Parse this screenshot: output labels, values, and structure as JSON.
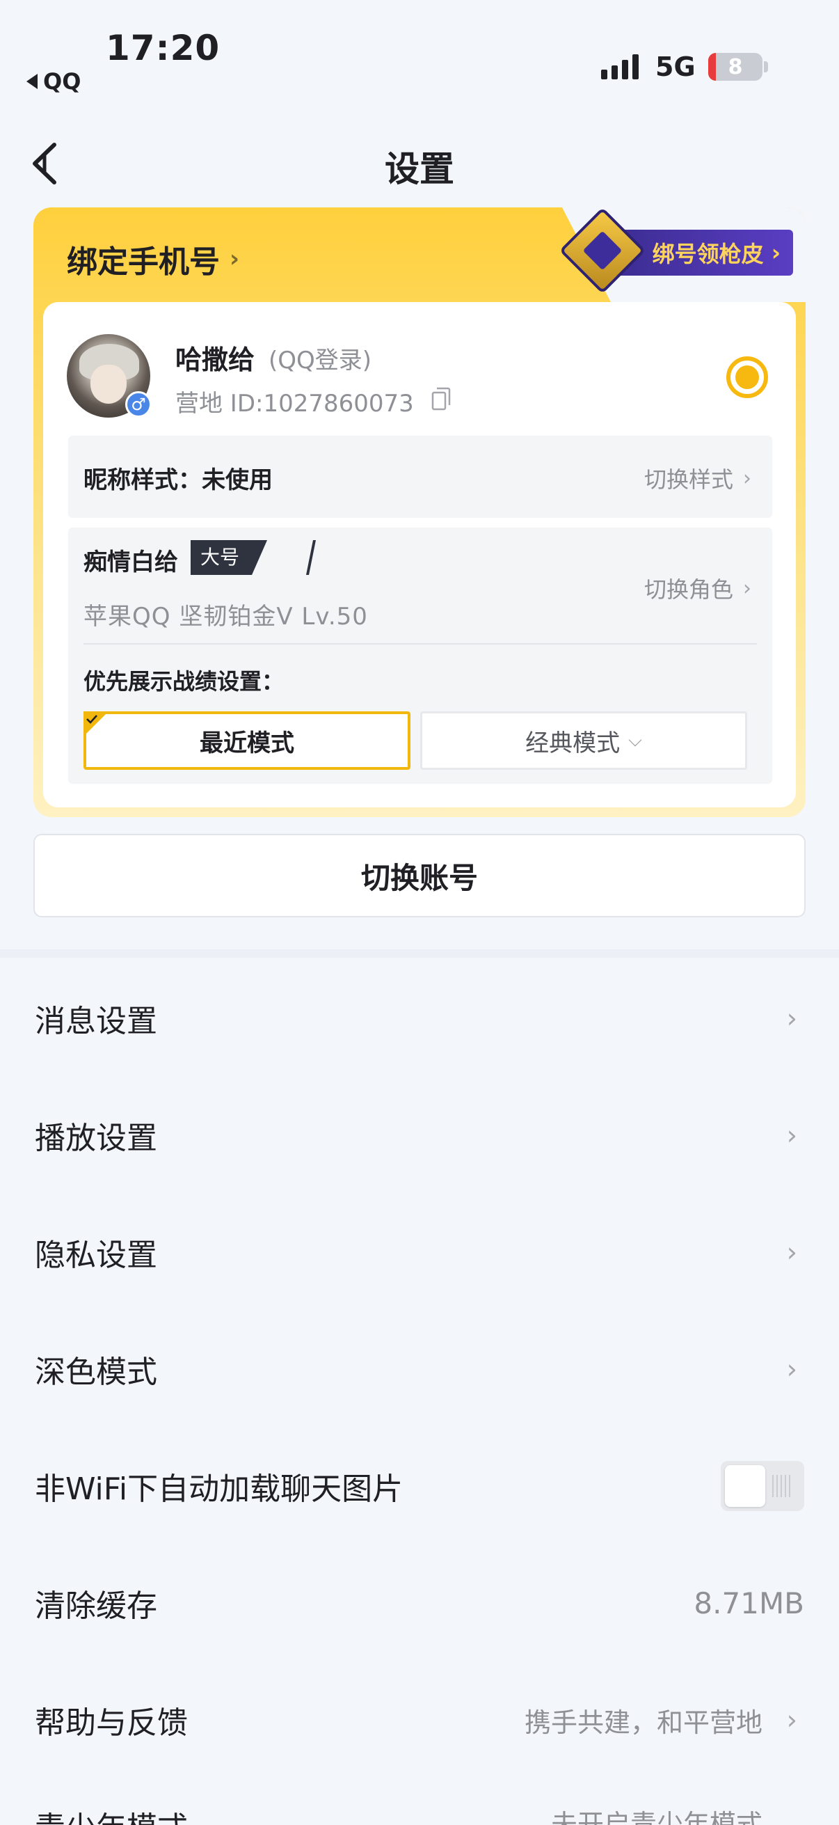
{
  "status_bar": {
    "time": "17:20",
    "back_app": "QQ",
    "network": "5G",
    "battery": "8"
  },
  "nav": {
    "title": "设置"
  },
  "account_card": {
    "bind_phone": "绑定手机号",
    "promo": "绑号领枪皮",
    "user_name": "哈撒给",
    "login_type": "(QQ登录)",
    "camp_id": "营地 ID:1027860073",
    "nickname_style_label": "昵称样式：未使用",
    "switch_style": "切换样式",
    "role_name": "痴情白给",
    "role_tag": "大号",
    "role_info": "苹果QQ  坚韧铂金Ⅴ  Lv.50",
    "switch_role": "切换角色",
    "priority_label": "优先展示战绩设置：",
    "mode_recent": "最近模式",
    "mode_classic": "经典模式",
    "accent_color": "#f7b90f"
  },
  "switch_account": "切换账号",
  "settings": [
    {
      "label": "消息设置"
    },
    {
      "label": "播放设置"
    },
    {
      "label": "隐私设置"
    },
    {
      "label": "深色模式"
    },
    {
      "label": "非WiFi下自动加载聊天图片",
      "toggle": false
    },
    {
      "label": "清除缓存",
      "value": "8.71MB"
    },
    {
      "label": "帮助与反馈",
      "sub": "携手共建，和平营地"
    }
  ],
  "partial_row": {
    "label": "青少年模式",
    "sub": "未开启青少年模式"
  }
}
